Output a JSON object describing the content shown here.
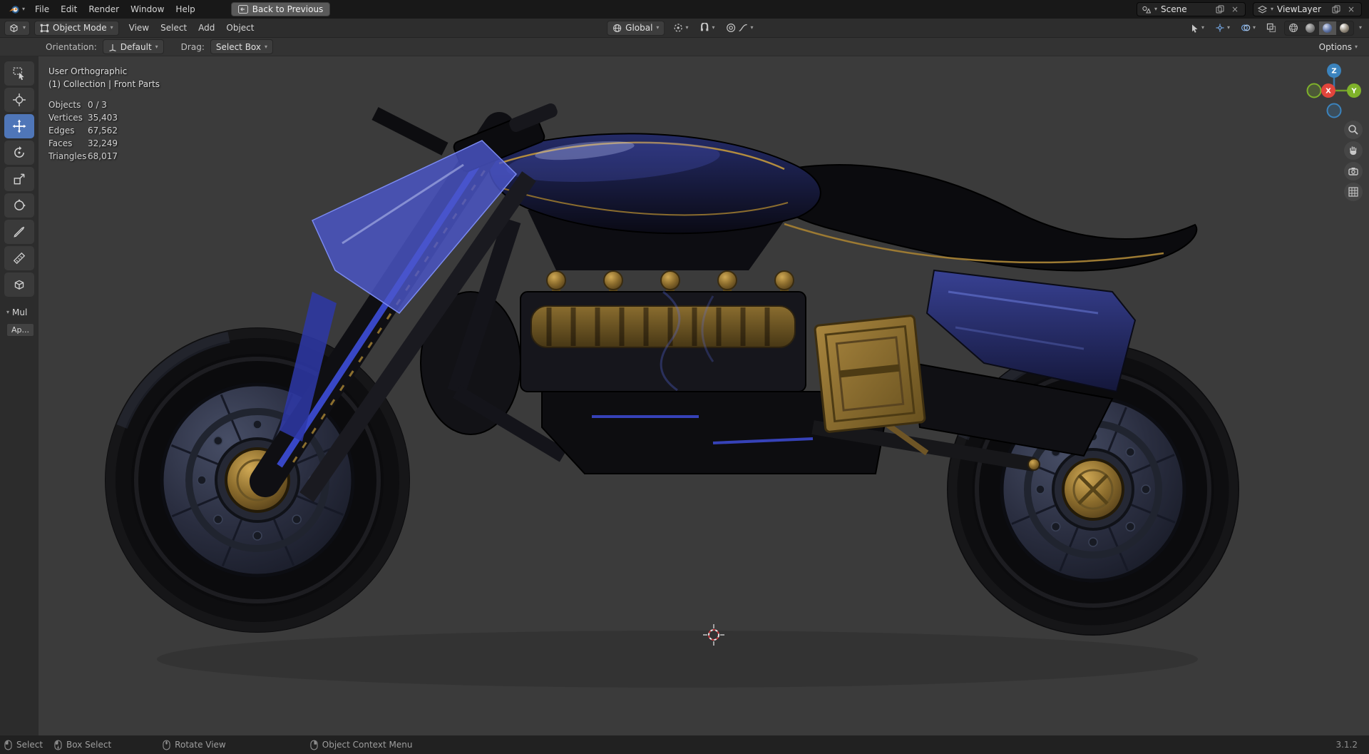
{
  "icons": {
    "chevron": "▾",
    "close": "×"
  },
  "topbar": {
    "menus": [
      "File",
      "Edit",
      "Render",
      "Window",
      "Help"
    ],
    "back_button": "Back to Previous",
    "scene": {
      "label": "Scene"
    },
    "viewlayer": {
      "label": "ViewLayer"
    }
  },
  "header": {
    "mode": "Object Mode",
    "menus": [
      "View",
      "Select",
      "Add",
      "Object"
    ],
    "orientation": "Global"
  },
  "tool_settings": {
    "orientation_label": "Orientation:",
    "orientation_value": "Default",
    "drag_label": "Drag:",
    "drag_value": "Select Box",
    "options": "Options"
  },
  "viewport": {
    "view_name": "User Orthographic",
    "collection": "(1) Collection | Front Parts",
    "stats": [
      {
        "label": "Objects",
        "value": "0 / 3"
      },
      {
        "label": "Vertices",
        "value": "35,403"
      },
      {
        "label": "Edges",
        "value": "67,562"
      },
      {
        "label": "Faces",
        "value": "32,249"
      },
      {
        "label": "Triangles",
        "value": "68,017"
      }
    ],
    "operator_panel": {
      "title": "Mul",
      "apply": "Ap..."
    }
  },
  "gizmo": {
    "x": "X",
    "y": "Y",
    "z": "Z"
  },
  "statusbar": {
    "select": "Select",
    "box_select": "Box Select",
    "rotate_view": "Rotate View",
    "object_context_menu": "Object Context Menu",
    "version": "3.1.2"
  },
  "colors": {
    "accent": "#4f76b8",
    "axis_x": "#e2453c",
    "axis_y": "#7fb22a",
    "axis_z": "#3b83bd"
  }
}
